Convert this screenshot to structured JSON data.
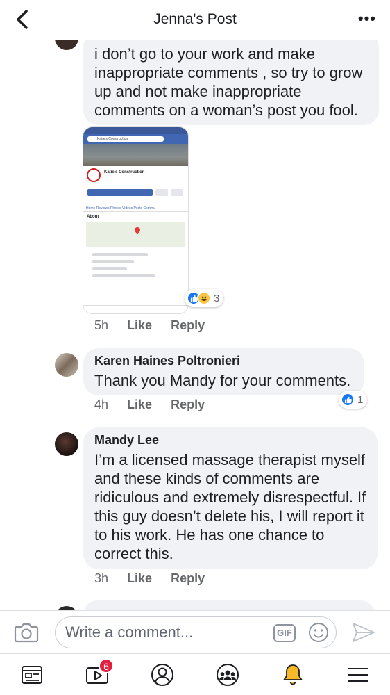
{
  "header": {
    "title": "Jenna's Post",
    "more_label": "•••"
  },
  "comments": [
    {
      "text": "i don’t go to your work and make inappropriate comments , so try to grow up and not make inappropriate comments on a woman’s post you fool.",
      "time": "5h",
      "like": "Like",
      "reply": "Reply",
      "reaction_count": "3",
      "attachment": {
        "page_name": "Katie's Construction",
        "search_text": "Katie's Construction",
        "tabs": "Home  Reviews  Photos  Videos  Posts  Commu",
        "about": "About"
      }
    },
    {
      "name": "Karen Haines Poltronieri",
      "text": "Thank you Mandy for your comments.",
      "time": "4h",
      "like": "Like",
      "reply": "Reply",
      "reaction_count": "1"
    },
    {
      "name": "Mandy Lee",
      "text": "I’m a licensed massage therapist myself and these kinds of comments are ridiculous and extremely disrespectful. If this guy doesn’t delete his, I will report it to his work. He has one chance to correct this.",
      "time": "3h",
      "like": "Like",
      "reply": "Reply"
    }
  ],
  "composer": {
    "placeholder": "Write a comment...",
    "gif_label": "GIF"
  },
  "bottom_nav": {
    "video_badge": "6"
  },
  "colors": {
    "accent": "#1877f2",
    "bubble": "#f0f2f5",
    "badge": "#e41e3f"
  }
}
